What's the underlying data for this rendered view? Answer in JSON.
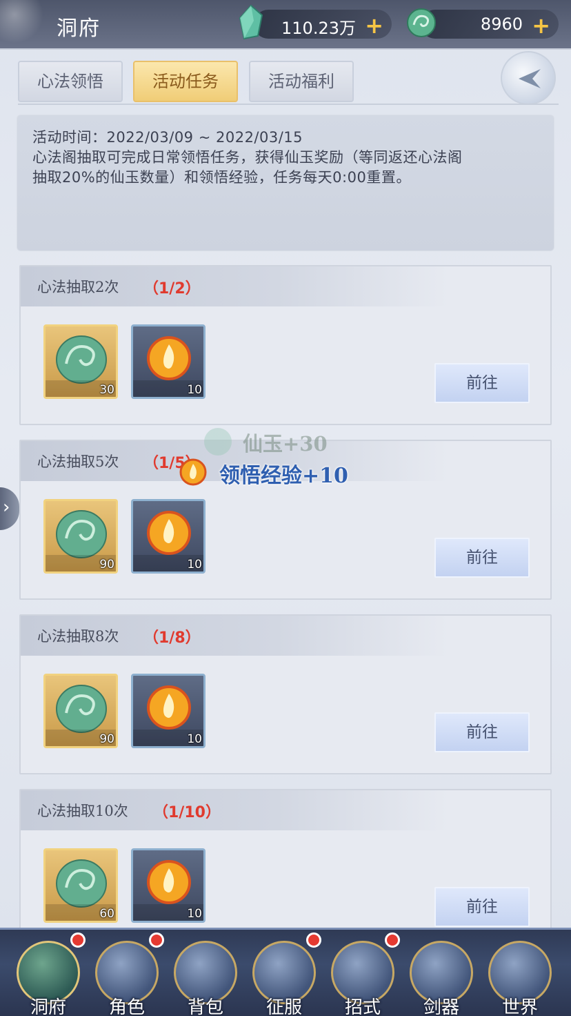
{
  "header": {
    "title": "洞府",
    "currency1": {
      "value": "110.23万",
      "icon": "crystal-icon"
    },
    "currency2": {
      "value": "8960",
      "icon": "jade-icon"
    },
    "plus": "+"
  },
  "tabs": [
    {
      "label": "心法领悟",
      "active": false
    },
    {
      "label": "活动任务",
      "active": true
    },
    {
      "label": "活动福利",
      "active": false
    }
  ],
  "info": {
    "line1": "活动时间：2022/03/09 ~ 2022/03/15",
    "line2": "心法阁抽取可完成日常领悟任务，获得仙玉奖励（等同返还心法阁",
    "line3": "抽取20%的仙玉数量）和领悟经验，任务每天0:00重置。"
  },
  "tasks": [
    {
      "title": "心法抽取2次",
      "progress": "（1/2）",
      "jade_qty": "30",
      "exp_qty": "10",
      "button": "前往"
    },
    {
      "title": "心法抽取5次",
      "progress": "（1/5）",
      "jade_qty": "90",
      "exp_qty": "10",
      "button": "前往"
    },
    {
      "title": "心法抽取8次",
      "progress": "（1/8）",
      "jade_qty": "90",
      "exp_qty": "10",
      "button": "前往"
    },
    {
      "title": "心法抽取10次",
      "progress": "（1/10）",
      "jade_qty": "60",
      "exp_qty": "10",
      "button": "前往"
    }
  ],
  "popups": {
    "reward1": "仙玉+30",
    "reward2": "领悟经验+10"
  },
  "nav": [
    {
      "label": "洞府",
      "badge": true
    },
    {
      "label": "角色",
      "badge": true
    },
    {
      "label": "背包",
      "badge": false
    },
    {
      "label": "征服",
      "badge": true
    },
    {
      "label": "招式",
      "badge": true
    },
    {
      "label": "剑器",
      "badge": false
    },
    {
      "label": "世界",
      "badge": false
    }
  ],
  "colors": {
    "progress": "#e03a2e",
    "plus": "#f6c545",
    "active_tab": "#f0cd77",
    "badge": "#e53a31"
  }
}
